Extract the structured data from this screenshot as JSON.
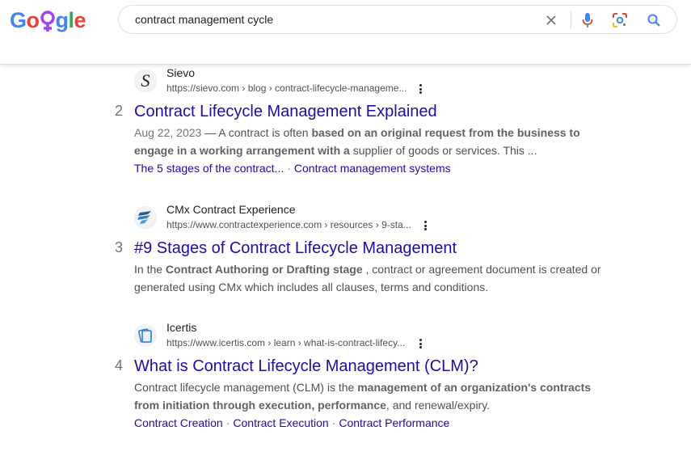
{
  "header": {
    "logo_letters": [
      "G",
      "o",
      "",
      "g",
      "l",
      "e"
    ],
    "search": {
      "value": "contract management cycle"
    }
  },
  "results": [
    {
      "number": "",
      "site_name": "Sievo",
      "url": "https://sievo.com › blog › contract-lifecycle-manageme...",
      "title": "Contract Lifecycle Management Explained",
      "date": "Aug 22, 2023",
      "snippet_pre": " — A contract is often ",
      "snippet_bold": "based on an original request from the business to engage in a working arrangement with a",
      "snippet_post": " supplier of goods or services. This ...",
      "sitelinks": [
        "The 5 stages of the contract...",
        "Contract management systems"
      ]
    },
    {
      "number": "3",
      "site_name": "CMx Contract Experience",
      "url": "https://www.contractexperience.com › resources › 9-sta...",
      "title": "#9 Stages of Contract Lifecycle Management",
      "snippet_pre": "In the ",
      "snippet_bold": "Contract Authoring or Drafting stage",
      "snippet_post": " , contract or agreement document is created or generated using CMx which includes all clauses, terms and conditions."
    },
    {
      "number": "4",
      "site_name": "Icertis",
      "url": "https://www.icertis.com › learn › what-is-contract-lifecy...",
      "title": "What is Contract Lifecycle Management (CLM)?",
      "snippet_pre": "Contract lifecycle management (CLM) is the ",
      "snippet_bold": "management of an organization's contracts from initiation through execution, performance",
      "snippet_post": ", and renewal/expiry.",
      "sitelinks": [
        "Contract Creation",
        "Contract Execution",
        "Contract Performance"
      ]
    }
  ],
  "first_number": "2",
  "icons": {
    "clear": "close-icon",
    "voice": "microphone-icon",
    "lens": "lens-icon",
    "search": "search-icon",
    "more": "more-vert-icon"
  },
  "colors": {
    "link": "#1a0dab",
    "text": "#4d5156",
    "blue": "#4285f4",
    "red": "#ea4335",
    "yellow": "#fbbc05",
    "green": "#34a853",
    "doodle": "#a142f4"
  }
}
